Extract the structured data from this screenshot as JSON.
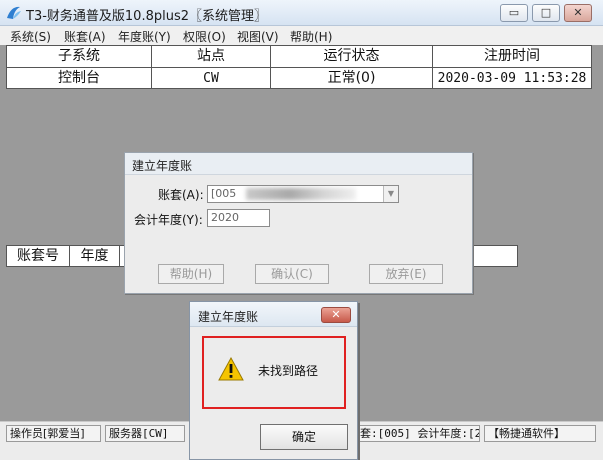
{
  "window": {
    "title": "T3-财务通普及版10.8plus2〖系统管理〗",
    "controls": {
      "minimize": "▭",
      "maximize": "□",
      "close": "✕"
    }
  },
  "menu": [
    "系统(S)",
    "账套(A)",
    "年度账(Y)",
    "权限(O)",
    "视图(V)",
    "帮助(H)"
  ],
  "subsystems": {
    "headers": [
      "子系统",
      "站点",
      "运行状态",
      "注册时间"
    ],
    "rows": [
      [
        "控制台",
        "CW",
        "正常(0)",
        "2020-03-09 11:53:28"
      ]
    ]
  },
  "accounts_table": {
    "headers": [
      "账套号",
      "年度"
    ]
  },
  "create_dialog": {
    "title": "建立年度账",
    "account_label": "账套(A):",
    "account_value": "[005",
    "year_label": "会计年度(Y):",
    "year_value": "2020",
    "buttons": {
      "help": "帮助(H)",
      "confirm": "确认(C)",
      "abandon": "放弃(E)"
    }
  },
  "alert": {
    "title": "建立年度账",
    "close": "✕",
    "message": "未找到路径",
    "ok": "确定"
  },
  "status": {
    "operator": "操作员[郭爱当]",
    "server": "服务器[CW]",
    "account_info": "套:[005] 会计年度:[2",
    "brand": "【畅捷通软件】"
  },
  "colors": {
    "alert_highlight": "#e02020",
    "workspace": "#9a9a9a"
  }
}
